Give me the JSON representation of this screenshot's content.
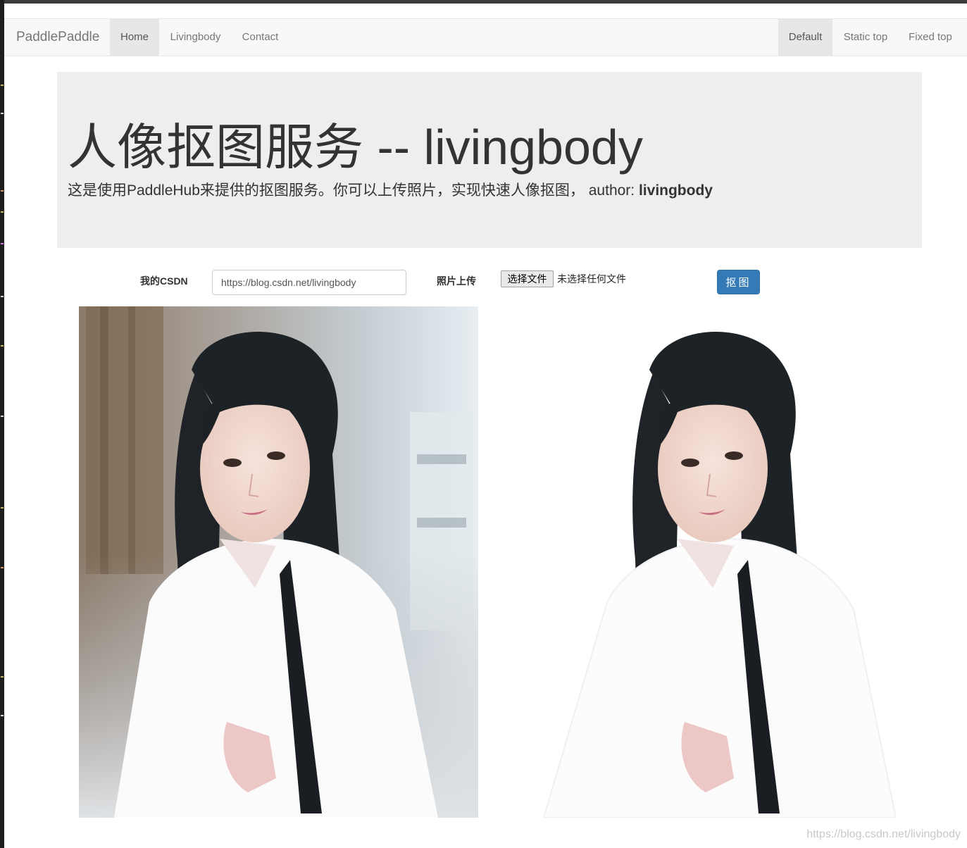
{
  "navbar": {
    "brand": "PaddlePaddle",
    "items": [
      {
        "label": "Home",
        "active": true
      },
      {
        "label": "Livingbody",
        "active": false
      },
      {
        "label": "Contact",
        "active": false
      }
    ],
    "right_items": [
      {
        "label": "Default",
        "active": true
      },
      {
        "label": "Static top",
        "active": false
      },
      {
        "label": "Fixed top",
        "active": false
      }
    ]
  },
  "jumbotron": {
    "title": "人像抠图服务 -- livingbody",
    "lead": "这是使用PaddleHub来提供的抠图服务。你可以上传照片，实现快速人像抠图， author: ",
    "author": "livingbody"
  },
  "form": {
    "csdn_label": "我的CSDN",
    "csdn_value": "https://blog.csdn.net/livingbody",
    "upload_label": "照片上传",
    "file_button": "选择文件",
    "file_status": "未选择任何文件",
    "submit": "抠图"
  },
  "images": {
    "original_icon": "portrait-photo",
    "cutout_icon": "portrait-cutout"
  },
  "watermark": "https://blog.csdn.net/livingbody",
  "colors": {
    "primary": "#337ab7",
    "navbar_bg": "#f8f8f8",
    "jumbotron_bg": "#eeeeee"
  }
}
